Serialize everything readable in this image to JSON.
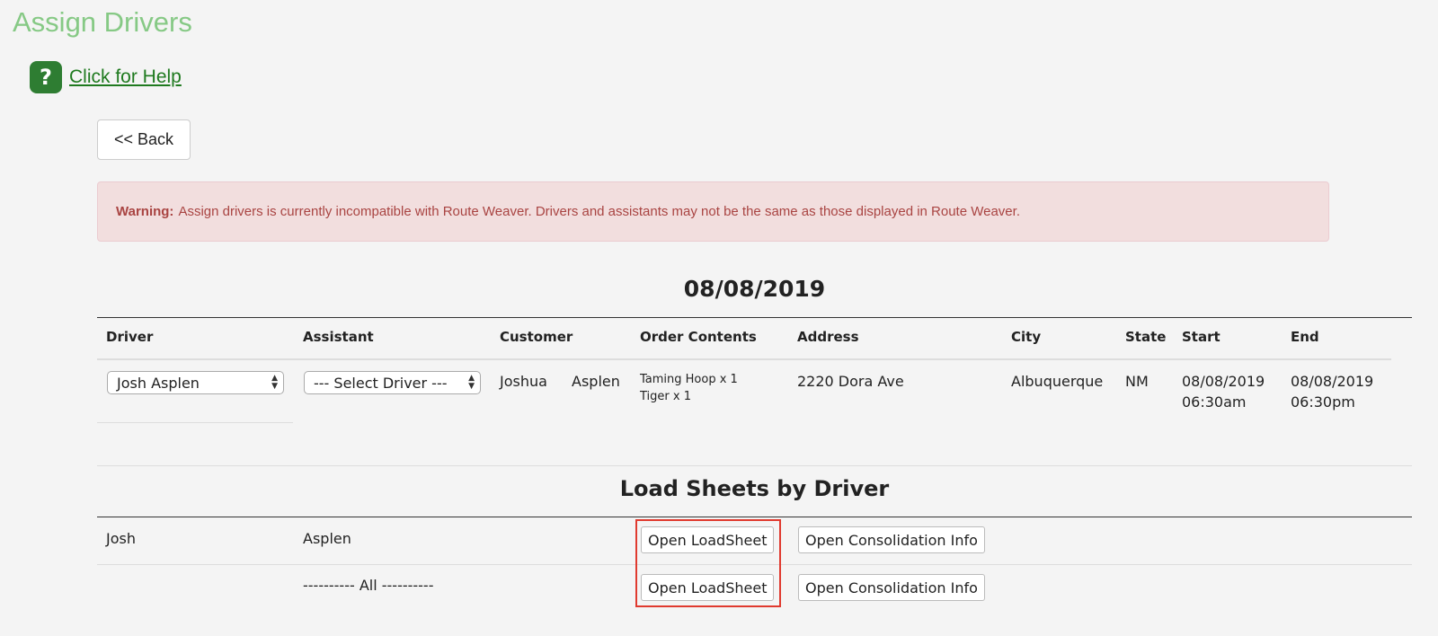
{
  "page": {
    "title": "Assign Drivers",
    "help_link": "Click for Help"
  },
  "icons": {
    "help": "help-question-icon",
    "select_arrows": "select-up-down-arrows-icon"
  },
  "colors": {
    "title": "#86c985",
    "help_icon": "#2e7d32",
    "warning_bg": "#f2dede",
    "warning_text": "#a94442",
    "highlight": "#e03a2f"
  },
  "toolbar": {
    "back_label": "<< Back"
  },
  "warning": {
    "label": "Warning:",
    "message": "Assign drivers is currently incompatible with Route Weaver. Drivers and assistants may not be the same as those displayed in Route Weaver."
  },
  "schedule": {
    "date": "08/08/2019",
    "columns": [
      "Driver",
      "Assistant",
      "Customer",
      "Order Contents",
      "Address",
      "City",
      "State",
      "Start",
      "End"
    ],
    "row": {
      "driver": "Josh Asplen",
      "assistant": "--- Select Driver ---",
      "customer_first": "Joshua",
      "customer_last": "Asplen",
      "order_contents": [
        "Taming Hoop x 1",
        "Tiger x 1"
      ],
      "address": "2220 Dora Ave",
      "city": "Albuquerque",
      "state": "NM",
      "start_date": "08/08/2019",
      "start_time": "06:30am",
      "end_date": "08/08/2019",
      "end_time": "06:30pm"
    }
  },
  "load_sheets": {
    "heading": "Load Sheets by Driver",
    "rows": [
      {
        "first": "Josh",
        "last": "Asplen",
        "open_label": "Open LoadSheet",
        "consolidation_label": "Open Consolidation Info"
      },
      {
        "first": "",
        "last": "---------- All ----------",
        "open_label": "Open LoadSheet",
        "consolidation_label": "Open Consolidation Info"
      }
    ]
  }
}
